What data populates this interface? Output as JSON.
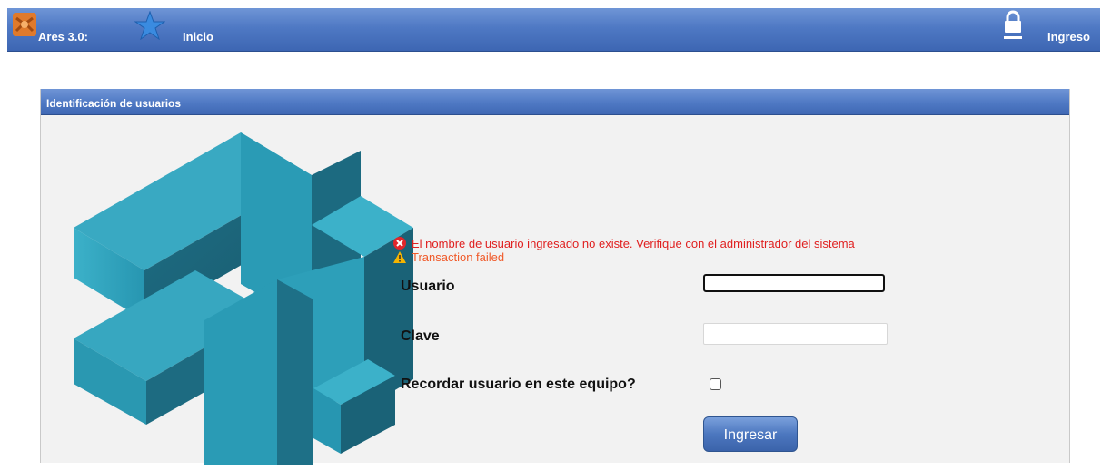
{
  "topbar": {
    "app_name": "Ares 3.0:",
    "home_label": "Inicio",
    "login_label": "Ingreso"
  },
  "panel": {
    "title": "Identificación de usuarios"
  },
  "messages": {
    "error": "El nombre de usuario ingresado no existe. Verifique con el administrador del sistema",
    "warning": "Transaction failed"
  },
  "form": {
    "user_label": "Usuario",
    "user_value": "",
    "password_label": "Clave",
    "password_value": "",
    "remember_label": "Recordar usuario en este equipo?",
    "remember_checked": false,
    "submit_label": "Ingresar"
  },
  "colors": {
    "bar_blue": "#4f79c4",
    "logo_teal": "#2a9bb5",
    "error_red": "#e01f1f"
  }
}
